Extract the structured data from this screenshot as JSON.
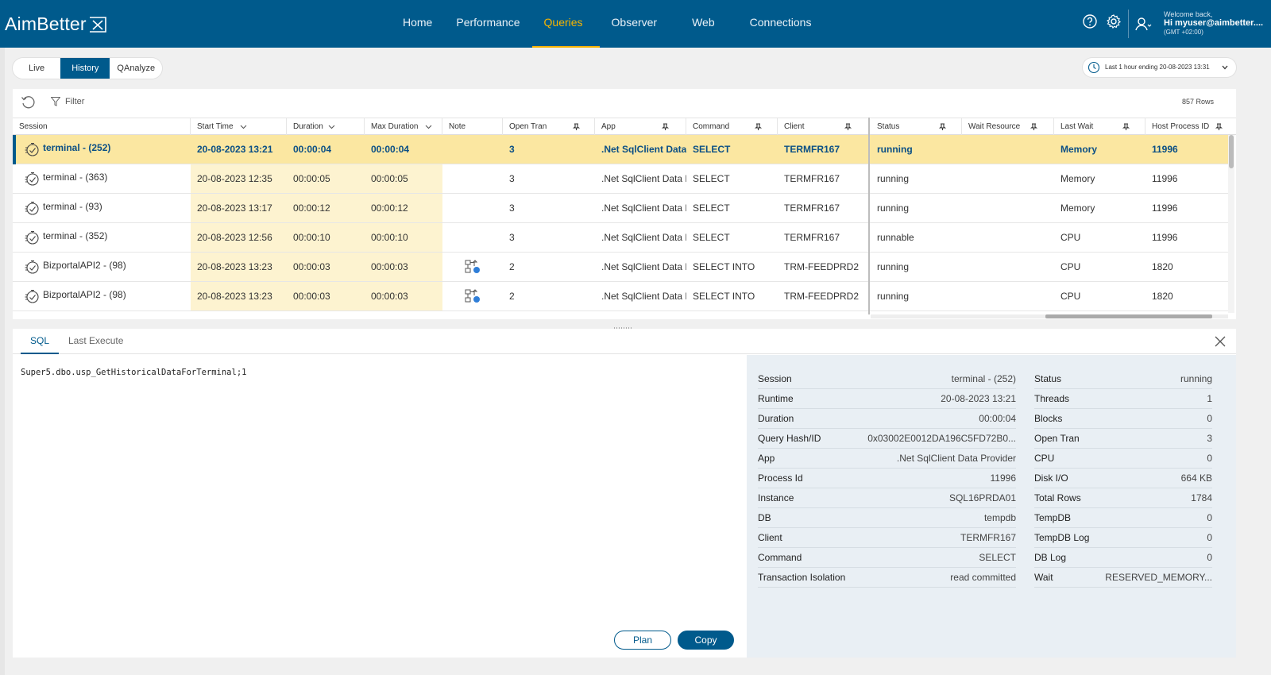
{
  "app": {
    "logo": "AimBetter"
  },
  "nav": {
    "items": [
      {
        "label": "Home"
      },
      {
        "label": "Performance"
      },
      {
        "label": "Queries",
        "active": true
      },
      {
        "label": "Observer"
      },
      {
        "label": "Web"
      },
      {
        "label": "Connections"
      }
    ]
  },
  "user": {
    "welcome": "Welcome back,",
    "name": "Hi myuser@aimbetter....",
    "tz": "(GMT +02:00)"
  },
  "subtabs": [
    {
      "label": "Live"
    },
    {
      "label": "History",
      "active": true
    },
    {
      "label": "QAnalyze"
    }
  ],
  "timerange": {
    "label": "Last 1 hour ending  20-08-2023 13:31"
  },
  "toolbar": {
    "filter_label": "Filter",
    "row_count": "857 Rows"
  },
  "table": {
    "columns": [
      "Session",
      "Start Time",
      "Duration",
      "Max Duration",
      "Note",
      "Open Tran",
      "App",
      "Command",
      "Client",
      "Status",
      "Wait Resource",
      "Last Wait",
      "Host Process ID"
    ],
    "rows": [
      {
        "session": "terminal - (252)",
        "start": "20-08-2023 13:21",
        "duration": "00:00:04",
        "max": "00:00:04",
        "note": "",
        "open": "3",
        "app": ".Net SqlClient Data F",
        "command": "SELECT",
        "client": "TERMFR167",
        "status": "running",
        "wait_res": "",
        "last_wait": "Memory",
        "host": "11996"
      },
      {
        "session": "terminal - (363)",
        "start": "20-08-2023 12:35",
        "duration": "00:00:05",
        "max": "00:00:05",
        "note": "",
        "open": "3",
        "app": ".Net SqlClient Data F",
        "command": "SELECT",
        "client": "TERMFR167",
        "status": "running",
        "wait_res": "",
        "last_wait": "Memory",
        "host": "11996"
      },
      {
        "session": "terminal - (93)",
        "start": "20-08-2023 13:17",
        "duration": "00:00:12",
        "max": "00:00:12",
        "note": "",
        "open": "3",
        "app": ".Net SqlClient Data F",
        "command": "SELECT",
        "client": "TERMFR167",
        "status": "running",
        "wait_res": "",
        "last_wait": "Memory",
        "host": "11996"
      },
      {
        "session": "terminal - (352)",
        "start": "20-08-2023 12:56",
        "duration": "00:00:10",
        "max": "00:00:10",
        "note": "",
        "open": "3",
        "app": ".Net SqlClient Data F",
        "command": "SELECT",
        "client": "TERMFR167",
        "status": "runnable",
        "wait_res": "",
        "last_wait": "CPU",
        "host": "11996"
      },
      {
        "session": "BizportalAPI2 - (98)",
        "start": "20-08-2023 13:23",
        "duration": "00:00:03",
        "max": "00:00:03",
        "note": "plan",
        "open": "2",
        "app": ".Net SqlClient Data F",
        "command": "SELECT INTO",
        "client": "TRM-FEEDPRD2",
        "status": "running",
        "wait_res": "",
        "last_wait": "CPU",
        "host": "1820"
      },
      {
        "session": "BizportalAPI2 - (98)",
        "start": "20-08-2023 13:23",
        "duration": "00:00:03",
        "max": "00:00:03",
        "note": "plan",
        "open": "2",
        "app": ".Net SqlClient Data F",
        "command": "SELECT INTO",
        "client": "TRM-FEEDPRD2",
        "status": "running",
        "wait_res": "",
        "last_wait": "CPU",
        "host": "1820"
      }
    ]
  },
  "detail": {
    "tabs": [
      {
        "label": "SQL",
        "active": true
      },
      {
        "label": "Last Execute"
      }
    ],
    "sql": "Super5.dbo.usp_GetHistoricalDataForTerminal;1",
    "plan_label": "Plan",
    "copy_label": "Copy",
    "left": [
      {
        "k": "Session",
        "v": "terminal - (252)"
      },
      {
        "k": "Runtime",
        "v": "20-08-2023 13:21"
      },
      {
        "k": "Duration",
        "v": "00:00:04"
      },
      {
        "k": "Query Hash/ID",
        "v": "0x03002E0012DA196C5FD72B0..."
      },
      {
        "k": "App",
        "v": ".Net SqlClient Data Provider"
      },
      {
        "k": "Process Id",
        "v": "11996"
      },
      {
        "k": "Instance",
        "v": "SQL16PRDA01"
      },
      {
        "k": "DB",
        "v": "tempdb"
      },
      {
        "k": "Client",
        "v": "TERMFR167"
      },
      {
        "k": "Command",
        "v": "SELECT"
      },
      {
        "k": "Transaction Isolation",
        "v": "read committed"
      }
    ],
    "right": [
      {
        "k": "Status",
        "v": "running"
      },
      {
        "k": "Threads",
        "v": "1"
      },
      {
        "k": "Blocks",
        "v": "0"
      },
      {
        "k": "Open Tran",
        "v": "3"
      },
      {
        "k": "CPU",
        "v": "0"
      },
      {
        "k": "Disk I/O",
        "v": "664 KB"
      },
      {
        "k": "Total Rows",
        "v": "1784"
      },
      {
        "k": "TempDB",
        "v": "0"
      },
      {
        "k": "TempDB Log",
        "v": "0"
      },
      {
        "k": "DB Log",
        "v": "0"
      },
      {
        "k": "Wait",
        "v": "RESERVED_MEMORY..."
      }
    ]
  },
  "colors": {
    "brand": "#005a8c",
    "accent": "#f5b400",
    "selected_row": "#fbe7a1",
    "highlight_col": "#fdf3d0"
  }
}
